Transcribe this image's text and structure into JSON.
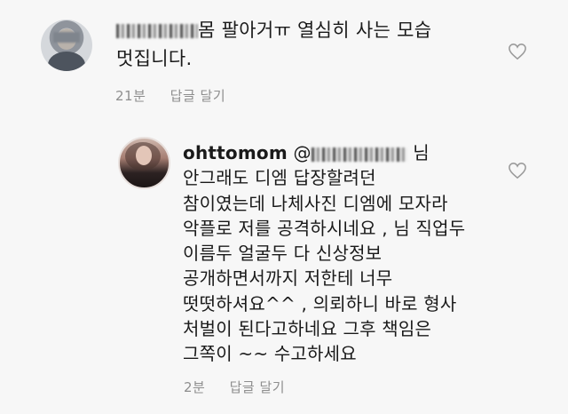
{
  "comment1": {
    "text_line1": "몸 팔아거ㅠ 열심히 사는 모습",
    "text_line2": "멋집니다.",
    "time": "21분",
    "reply_label": "답글 달기"
  },
  "comment2": {
    "username": "ohttomom",
    "mention_prefix": "@",
    "mention_suffix": "님",
    "lines": [
      "안그래도 디엠 답장할려던",
      "참이였는데 나체사진 디엠에 모자라",
      "악플로 저를 공격하시네요 , 님 직업두",
      "이름두 얼굴두 다 신상정보",
      "공개하면서까지 저한테 너무",
      "떳떳하셔요^^ , 의뢰하니 바로 형사",
      "처벌이 된다고하네요  그후 책임은",
      "그쪽이 ~~ 수고하세요"
    ],
    "time": "2분",
    "reply_label": "답글 달기"
  },
  "icons": {
    "like": "heart-outline-icon"
  },
  "colors": {
    "meta_text": "#8e8e8e",
    "body_text": "#1a1a1a",
    "background": "#f7f7f7"
  }
}
